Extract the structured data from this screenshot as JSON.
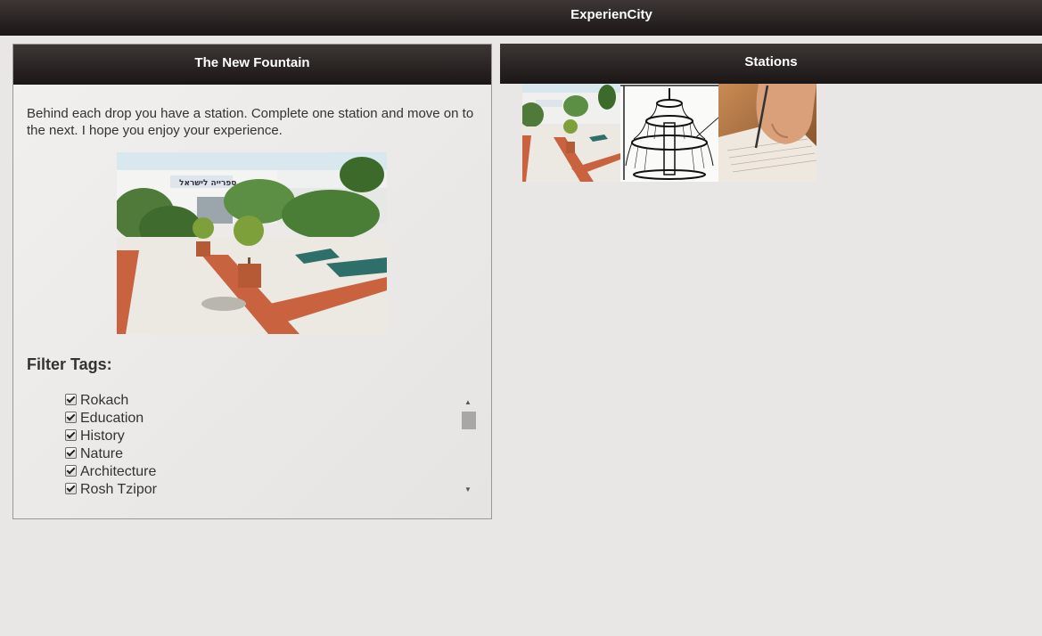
{
  "app": {
    "title": "ExperienCity"
  },
  "left_panel": {
    "title": "The New Fountain",
    "intro": "Behind each drop you have a station. Complete one station and move on to the next. I hope you enjoy your experience.",
    "filter_title": "Filter Tags:",
    "tags": [
      {
        "label": "Rokach",
        "checked": true
      },
      {
        "label": "Education",
        "checked": true
      },
      {
        "label": "History",
        "checked": true
      },
      {
        "label": "Nature",
        "checked": true
      },
      {
        "label": "Architecture",
        "checked": true
      },
      {
        "label": "Rosh Tzipor",
        "checked": true
      }
    ]
  },
  "stations": {
    "title": "Stations",
    "items": [
      {
        "icon": "courtyard-photo"
      },
      {
        "icon": "fountain-sketch"
      },
      {
        "icon": "writing-hand-photo"
      }
    ]
  },
  "colors": {
    "header_top": "#3d3634",
    "header_bottom": "#1b1716",
    "background": "#e9e7e5",
    "brick": "#c9623f"
  }
}
